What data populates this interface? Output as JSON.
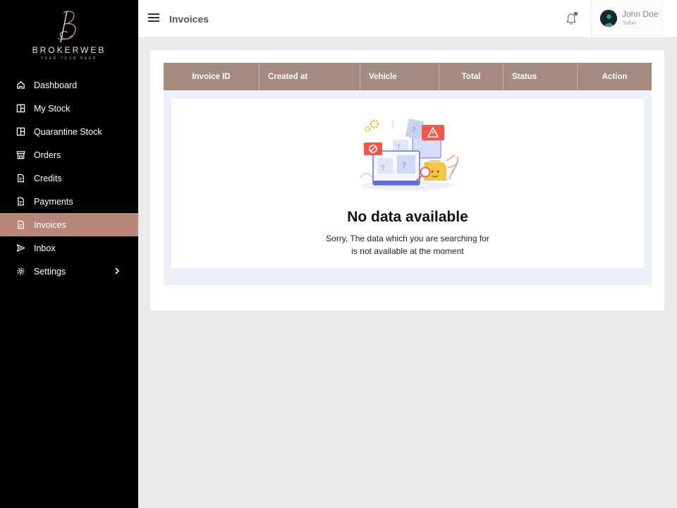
{
  "brand": {
    "name": "BROKERWEB",
    "tagline": "FEED YOUR NEED"
  },
  "sidebar": {
    "items": [
      {
        "label": "Dashboard",
        "icon": "home-icon"
      },
      {
        "label": "My Stock",
        "icon": "stock-icon"
      },
      {
        "label": "Quarantine Stock",
        "icon": "stock-icon"
      },
      {
        "label": "Orders",
        "icon": "store-icon"
      },
      {
        "label": "Credits",
        "icon": "document-icon"
      },
      {
        "label": "Payments",
        "icon": "document-icon"
      },
      {
        "label": "Invoices",
        "icon": "document-icon",
        "active": true
      },
      {
        "label": "Inbox",
        "icon": "send-icon"
      },
      {
        "label": "Settings",
        "icon": "gear-icon",
        "expandable": true
      }
    ]
  },
  "header": {
    "title": "Invoices",
    "user": {
      "name": "John Doe",
      "role": "Seller"
    }
  },
  "table": {
    "columns": [
      "Invoice ID",
      "Created at",
      "Vehicle",
      "Total",
      "Status",
      "Action"
    ]
  },
  "empty_state": {
    "title": "No data available",
    "line1": "Sorry, The data which you are searching for",
    "line2": "is not available at the moment"
  },
  "colors": {
    "sidebar_bg": "#000000",
    "active_item": "#b8877a",
    "table_header": "#a58a81",
    "notification_dot": "#e02424"
  }
}
